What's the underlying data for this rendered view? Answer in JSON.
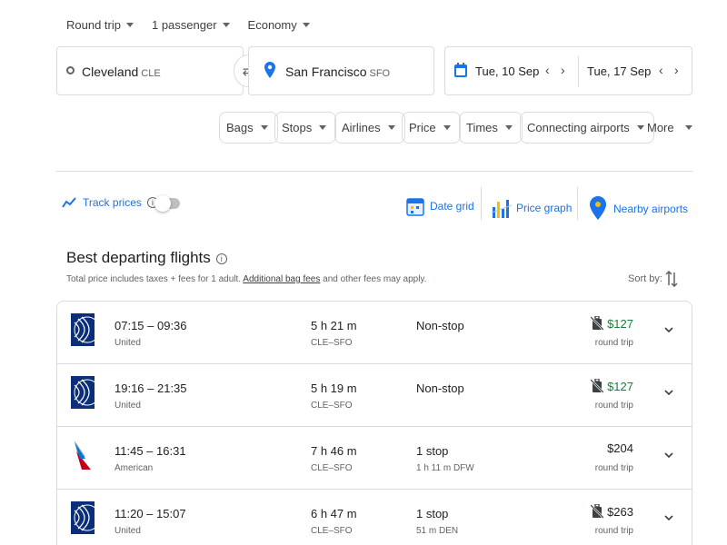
{
  "trip": {
    "type": "Round trip",
    "passengers": "1 passenger",
    "cabin": "Economy"
  },
  "search": {
    "origin_city": "Cleveland",
    "origin_code": "CLE",
    "destination_city": "San Francisco",
    "destination_code": "SFO",
    "depart_date": "Tue, 10 Sep",
    "return_date": "Tue, 17 Sep"
  },
  "filters": [
    "Bags",
    "Stops",
    "Airlines",
    "Price",
    "Times",
    "Connecting airports"
  ],
  "more_label": "More",
  "tools": {
    "track_prices": "Track prices",
    "date_grid": "Date grid",
    "price_graph": "Price graph",
    "nearby_airports": "Nearby airports"
  },
  "results": {
    "heading": "Best departing flights",
    "note_prefix": "Total price includes taxes + fees for 1 adult. ",
    "note_link": "Additional bag fees",
    "note_suffix": " and other fees may apply.",
    "sort_label": "Sort by:"
  },
  "flights": [
    {
      "times": "07:15 – 09:36",
      "airline": "United",
      "duration": "5 h 21 m",
      "route": "CLE–SFO",
      "stops": "Non-stop",
      "stop_detail": "",
      "price": "$127",
      "trip": "round trip"
    },
    {
      "times": "19:16 – 21:35",
      "airline": "United",
      "duration": "5 h 19 m",
      "route": "CLE–SFO",
      "stops": "Non-stop",
      "stop_detail": "",
      "price": "$127",
      "trip": "round trip"
    },
    {
      "times": "11:45 – 16:31",
      "airline": "American",
      "duration": "7 h 46 m",
      "route": "CLE–SFO",
      "stops": "1 stop",
      "stop_detail": "1 h 11 m DFW",
      "price": "$204",
      "trip": "round trip"
    },
    {
      "times": "11:20 – 15:07",
      "airline": "United",
      "duration": "6 h 47 m",
      "route": "CLE–SFO",
      "stops": "1 stop",
      "stop_detail": "51 m DEN",
      "price": "$263",
      "trip": "round trip"
    }
  ],
  "colors": {
    "accent": "#1a73e8",
    "price_low": "#188038",
    "border": "#dadce0"
  }
}
